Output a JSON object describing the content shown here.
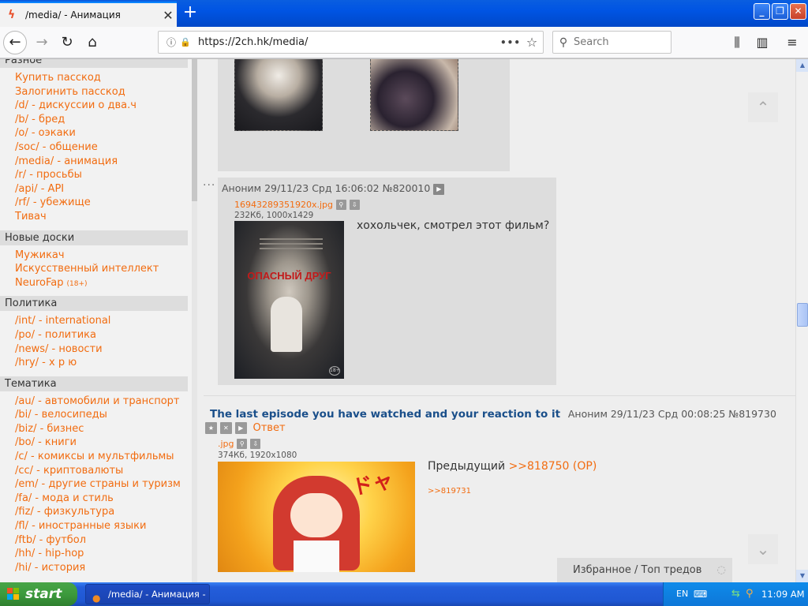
{
  "browser": {
    "tab_title": "/media/ - Анимация",
    "url": "https://2ch.hk/media/",
    "search_placeholder": "Search"
  },
  "sidebar": {
    "sections": [
      {
        "title": "Разное",
        "items": [
          {
            "label": "Купить пасскод"
          },
          {
            "label": "Залогинить пасскод"
          },
          {
            "label": "/d/ - дискуссии о два.ч"
          },
          {
            "label": "/b/ - бред"
          },
          {
            "label": "/o/ - оэкаки"
          },
          {
            "label": "/soc/ - общение"
          },
          {
            "label": "/media/ - анимация"
          },
          {
            "label": "/r/ - просьбы"
          },
          {
            "label": "/api/ - API"
          },
          {
            "label": "/rf/ - убежище"
          },
          {
            "label": "Тивач"
          }
        ]
      },
      {
        "title": "Новые доски",
        "items": [
          {
            "label": "Мужикач"
          },
          {
            "label": "Искусственный интеллект"
          },
          {
            "label": "NeuroFap",
            "sup": "(18+)"
          }
        ]
      },
      {
        "title": "Политика",
        "items": [
          {
            "label": "/int/ - international"
          },
          {
            "label": "/po/ - политика"
          },
          {
            "label": "/news/ - новости"
          },
          {
            "label": "/hry/ - х р ю"
          }
        ]
      },
      {
        "title": "Тематика",
        "items": [
          {
            "label": "/au/ - автомобили и транспорт"
          },
          {
            "label": "/bi/ - велосипеды"
          },
          {
            "label": "/biz/ - бизнес"
          },
          {
            "label": "/bo/ - книги"
          },
          {
            "label": "/c/ - комиксы и мультфильмы"
          },
          {
            "label": "/cc/ - криптовалюты"
          },
          {
            "label": "/em/ - другие страны и туризм"
          },
          {
            "label": "/fa/ - мода и стиль"
          },
          {
            "label": "/fiz/ - физкультура"
          },
          {
            "label": "/fl/ - иностранные языки"
          },
          {
            "label": "/ftb/ - футбол"
          },
          {
            "label": "/hh/ - hip-hop"
          },
          {
            "label": "/hi/ - история"
          }
        ]
      }
    ]
  },
  "reply_post": {
    "author": "Аноним",
    "datetime": "29/11/23 Срд 16:06:02",
    "number": "№820010",
    "file_name": "16943289351920x.jpg",
    "file_info": "232Кб, 1000x1429",
    "poster_title": "ОПАСНЫЙ ДРУГ",
    "poster_rating": "18+",
    "text": "хохольчек, смотрел этот фильм?"
  },
  "thread": {
    "title": "The last episode you have watched and your reaction to it",
    "author": "Аноним",
    "datetime": "29/11/23 Срд 00:08:25",
    "number": "№819730",
    "reply_label": "Ответ",
    "file_name": ".jpg",
    "file_info": "374Кб, 1920x1080",
    "body_prefix": "Предыдущий",
    "body_link": ">>818750 (OP)",
    "backlink": ">>819731"
  },
  "floating": {
    "favorites_label": "Избранное / Топ тредов"
  },
  "taskbar": {
    "start_label": "start",
    "task_label": "/media/ - Анимация - ...",
    "lang": "EN",
    "clock": "11:09 AM"
  },
  "colors": {
    "link": "#f26c10",
    "thread_title": "#1a4f8a",
    "post_bg": "#dddddd",
    "page_bg": "#eeeeee",
    "taskbar_blue": "#245edb"
  }
}
